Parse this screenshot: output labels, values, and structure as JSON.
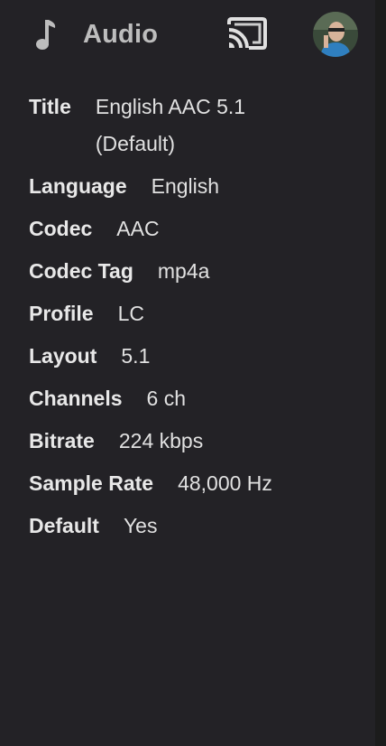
{
  "header": {
    "title": "Audio",
    "icons": {
      "music": "music-note-icon",
      "cast": "cast-icon",
      "avatar": "user-avatar"
    }
  },
  "audio_info": [
    {
      "label": "Title",
      "value": "English AAC 5.1 (Default)"
    },
    {
      "label": "Language",
      "value": "English"
    },
    {
      "label": "Codec",
      "value": "AAC"
    },
    {
      "label": "Codec Tag",
      "value": "mp4a"
    },
    {
      "label": "Profile",
      "value": "LC"
    },
    {
      "label": "Layout",
      "value": "5.1"
    },
    {
      "label": "Channels",
      "value": "6 ch"
    },
    {
      "label": "Bitrate",
      "value": "224 kbps"
    },
    {
      "label": "Sample Rate",
      "value": "48,000 Hz"
    },
    {
      "label": "Default",
      "value": "Yes"
    }
  ],
  "colors": {
    "background": "#232226",
    "header_text": "#bdbdbd",
    "label_text": "#e8e8e8",
    "value_text": "#e1e1e1"
  }
}
